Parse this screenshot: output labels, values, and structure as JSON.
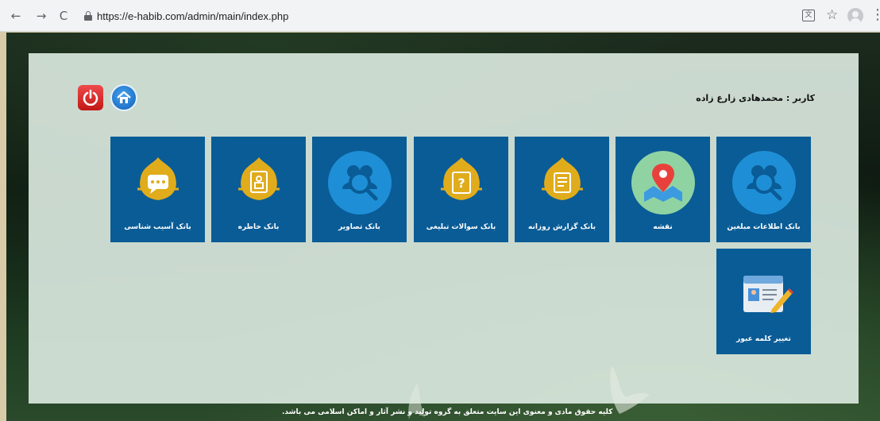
{
  "browser": {
    "back": "←",
    "forward": "→",
    "reload": "C",
    "url": "https://e-habib.com/admin/main/index.php",
    "star": "☆",
    "menu": "⋮"
  },
  "header": {
    "user_label": "کاربر : محمدهادی زارع زاده"
  },
  "tiles": [
    {
      "label": "بانک اطلاعات مبلغین",
      "icon": "people-search-icon"
    },
    {
      "label": "نقشه",
      "icon": "map-pin-icon"
    },
    {
      "label": "بانک گزارش روزانه",
      "icon": "report-icon"
    },
    {
      "label": "بانک سوالات تبلیغی",
      "icon": "question-book-icon"
    },
    {
      "label": "بانک تصاویر",
      "icon": "people-search-icon"
    },
    {
      "label": "بانک خاطره",
      "icon": "memory-book-icon"
    },
    {
      "label": "بانک آسیب شناسی",
      "icon": "chat-icon"
    },
    {
      "label": "تغییر کلمه عبور",
      "icon": "id-card-edit-icon"
    }
  ],
  "footer": {
    "text": "کلیه حقوق مادی و معنوی این سایت متعلق به گروه تولید و نشر آثار و اماکن اسلامی می باشد."
  },
  "colors": {
    "tile": "#0a5c96",
    "panel": "#dae8de",
    "gold": "#d4a017"
  }
}
